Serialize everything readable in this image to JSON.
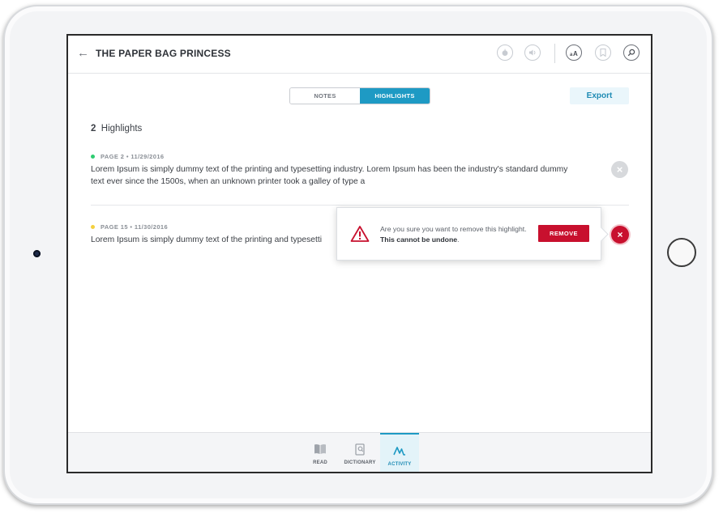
{
  "header": {
    "title": "THE PAPER BAG PRINCESS",
    "icons": [
      "apple-icon",
      "audio-icon",
      "text-size-icon",
      "bookmark-icon",
      "search-icon"
    ]
  },
  "tabs": {
    "notes": "NOTES",
    "highlights": "HIGHLIGHTS",
    "active": "HIGHLIGHTS"
  },
  "export_label": "Export",
  "summary": {
    "count": "2",
    "label": "Highlights"
  },
  "highlights": [
    {
      "meta": "PAGE 2 • 11/29/2016",
      "dot_color": "#2ecc71",
      "text": "Lorem Ipsum is simply dummy text of the printing and typesetting industry. Lorem Ipsum has been the industry's standard dummy text ever since the 1500s, when an unknown printer took a galley of type a"
    },
    {
      "meta": "PAGE 15 • 11/30/2016",
      "dot_color": "#f4d03f",
      "text": "Lorem Ipsum is simply dummy text of the printing and typesetti"
    }
  ],
  "confirm": {
    "message": "Are you sure you want to remove this highlight.",
    "emphasis": "This cannot be undone",
    "button": "REMOVE"
  },
  "bottom_nav": [
    {
      "label": "READ",
      "icon": "book-icon"
    },
    {
      "label": "DICTIONARY",
      "icon": "dictionary-icon"
    },
    {
      "label": "ACTIVITY",
      "icon": "activity-icon",
      "active": true
    }
  ],
  "colors": {
    "accent": "#1e9ac4",
    "danger": "#c8102e"
  }
}
